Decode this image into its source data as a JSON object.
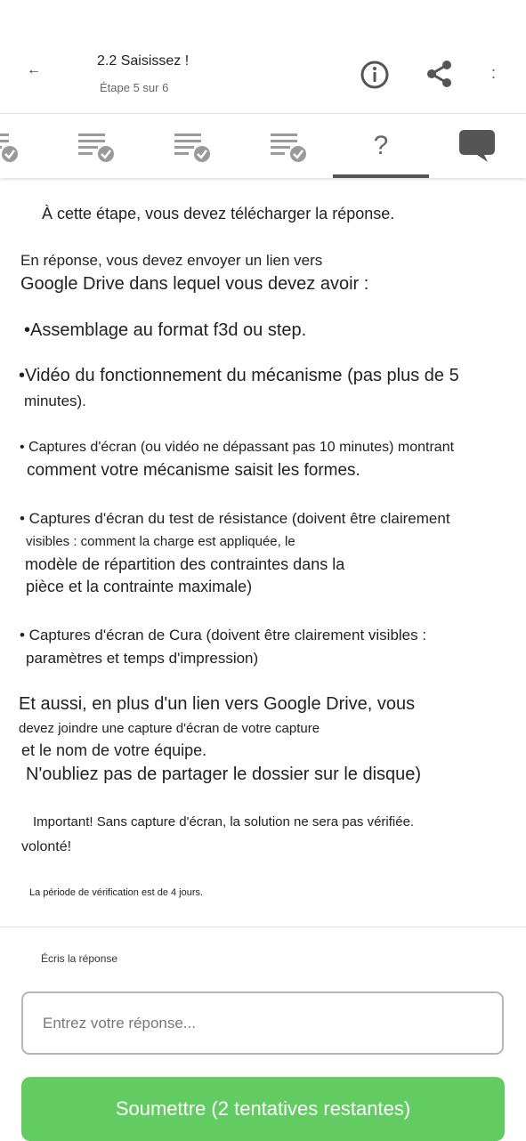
{
  "header": {
    "back_icon": "arrow-left-icon",
    "back_symbol": "←",
    "title": "2.2 Saisissez !",
    "subtitle": "Étape 5 sur 6",
    "actions": [
      "info-icon",
      "share-icon",
      "more-vertical-icon"
    ],
    "more_symbol": ":"
  },
  "tabs": [
    {
      "icon": "text-check-icon",
      "state": "completed"
    },
    {
      "icon": "text-check-icon",
      "state": "completed"
    },
    {
      "icon": "text-check-icon",
      "state": "completed"
    },
    {
      "icon": "text-check-icon",
      "state": "completed"
    },
    {
      "icon": "question-icon",
      "label": "?",
      "state": "active"
    },
    {
      "icon": "chat-bubble-icon",
      "state": "default"
    }
  ],
  "content": {
    "intro": "À cette étape, vous devez télécharger la réponse.",
    "line1": "En réponse, vous devez envoyer un lien vers",
    "line2": "Google Drive dans lequel vous devez avoir :",
    "bullet1": "•Assemblage au format f3d ou step.",
    "bullet2_a": "•Vidéo du fonctionnement du mécanisme (pas plus de 5",
    "bullet2_b": "minutes).",
    "bullet3_a": "• Captures d'écran (ou vidéo ne dépassant pas 10 minutes) montrant",
    "bullet3_b": "comment votre mécanisme saisit les formes.",
    "bullet4_a": "• Captures d'écran du test de résistance (doivent être clairement",
    "bullet4_b": "visibles : comment la charge est appliquée, le",
    "bullet4_c": "modèle de répartition des contraintes dans la",
    "bullet4_d": "pièce et la contrainte maximale)",
    "bullet5_a": "• Captures d'écran de Cura (doivent être clairement visibles :",
    "bullet5_b": "paramètres et temps d'impression)",
    "also_a": "Et aussi, en plus d'un lien vers Google Drive, vous",
    "also_b": "devez joindre une capture d'écran de votre capture",
    "also_c": "et le nom de votre équipe.",
    "also_d": "N'oubliez pas de partager le dossier sur le disque)",
    "important": "Important! Sans capture d'écran, la solution ne sera pas vérifiée.",
    "volonte": "volonté!",
    "period": "La période de vérification est de 4 jours."
  },
  "answer": {
    "label": "Écris la réponse",
    "placeholder": "Entrez votre réponse...",
    "value": "",
    "submit_label": "Soumettre (2 tentatives restantes)"
  },
  "colors": {
    "submit": "#62cc62",
    "icon": "#555555",
    "check_badge": "#9a9a9a"
  }
}
